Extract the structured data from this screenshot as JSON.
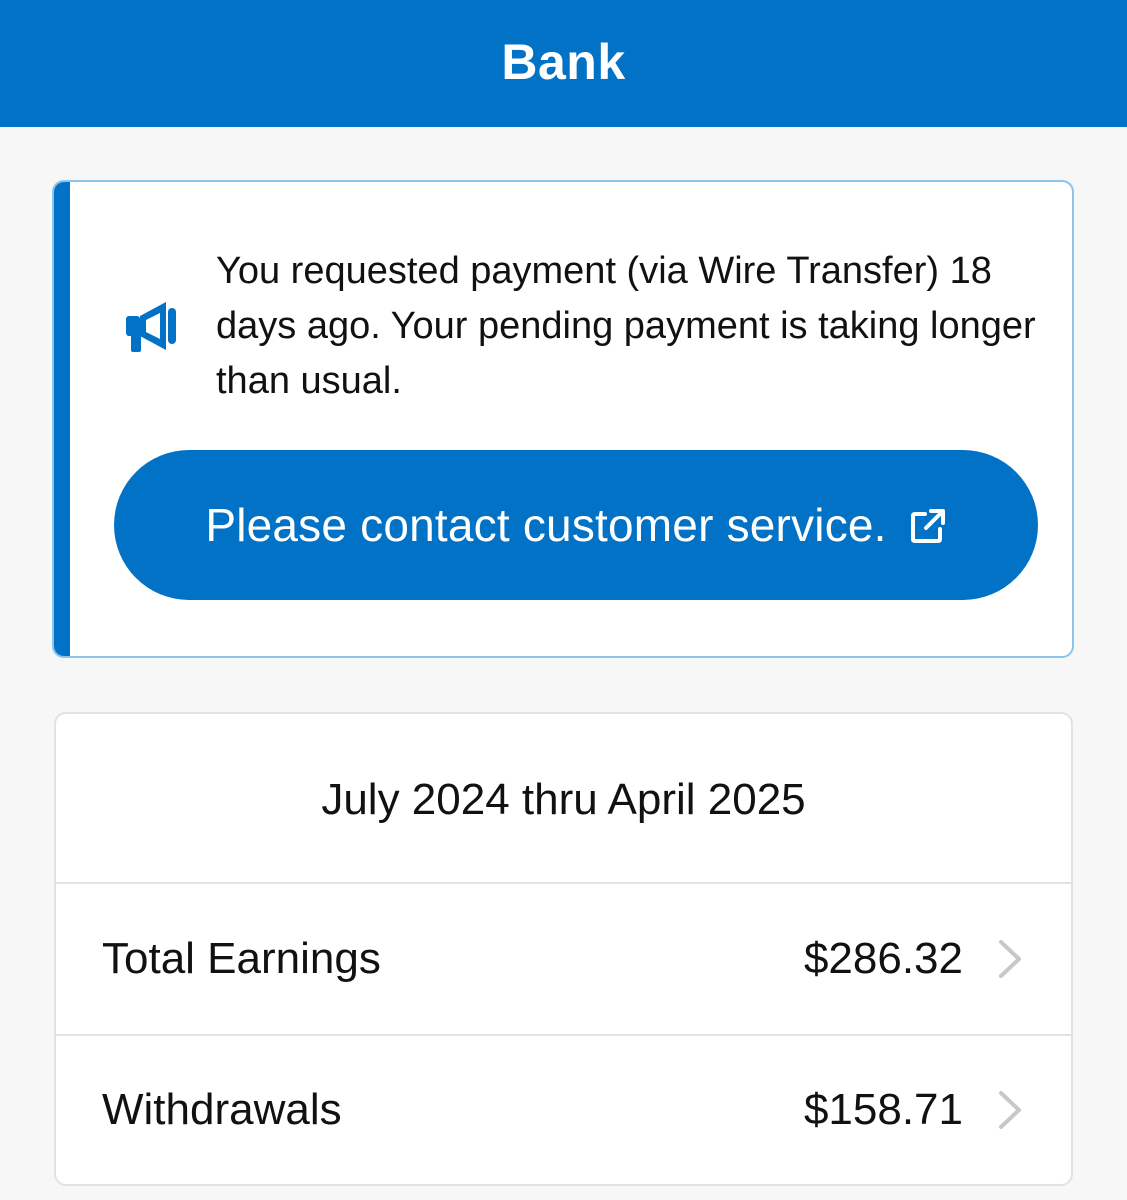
{
  "header": {
    "title": "Bank"
  },
  "alert": {
    "icon": "megaphone-icon",
    "message": "You requested payment (via Wire Transfer) 18 days ago. Your pending payment is taking longer than usual.",
    "button_label": "Please contact customer service.",
    "button_icon": "external-link-icon"
  },
  "summary": {
    "period": "July 2024 thru April 2025",
    "rows": [
      {
        "label": "Total Earnings",
        "value": "$286.32"
      },
      {
        "label": "Withdrawals",
        "value": "$158.71"
      }
    ]
  },
  "colors": {
    "accent": "#0272c6",
    "alert_border": "#8cc4ea",
    "background": "#f7f7f7",
    "chevron": "#c8c8c8"
  }
}
